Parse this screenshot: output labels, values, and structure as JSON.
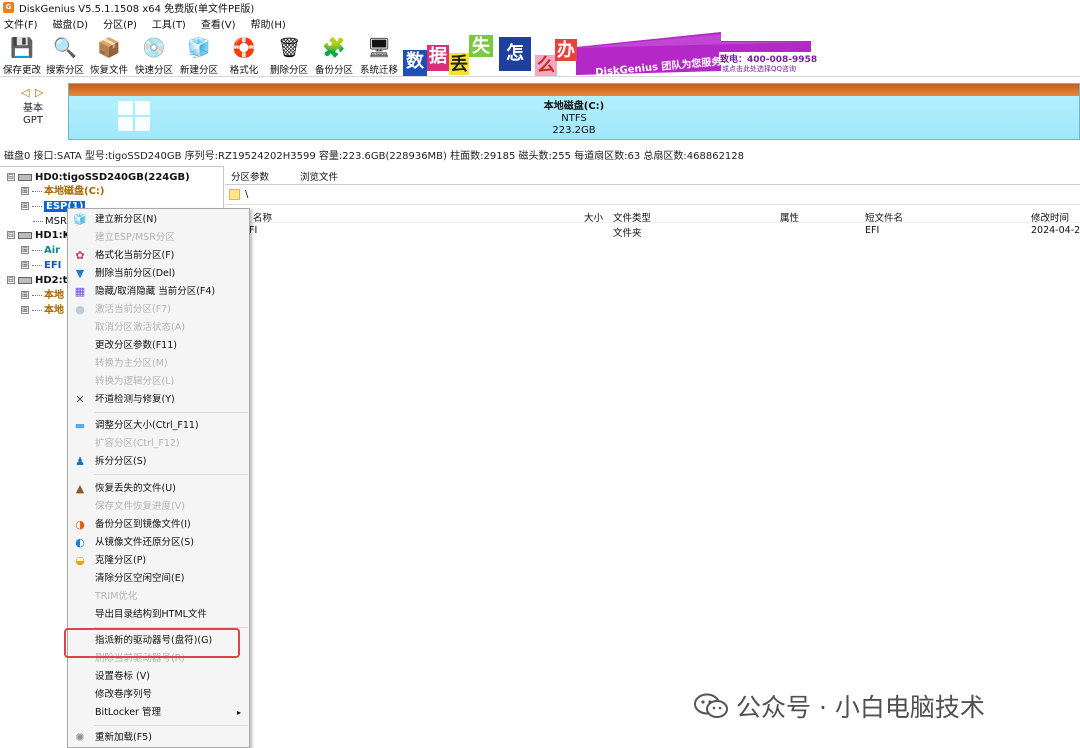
{
  "window": {
    "title": "DiskGenius V5.5.1.1508 x64 免费版(单文件PE版)",
    "app_icon_text": "G"
  },
  "menu": [
    {
      "label": "文件(F)"
    },
    {
      "label": "磁盘(D)"
    },
    {
      "label": "分区(P)"
    },
    {
      "label": "工具(T)"
    },
    {
      "label": "查看(V)"
    },
    {
      "label": "帮助(H)"
    }
  ],
  "toolbar": [
    {
      "label": "保存更改",
      "icon": "save-icon",
      "glyph": "💾"
    },
    {
      "label": "搜索分区",
      "icon": "search-icon",
      "glyph": "🔍"
    },
    {
      "label": "恢复文件",
      "icon": "restore-icon",
      "glyph": "📦"
    },
    {
      "label": "快速分区",
      "icon": "quick-partition-icon",
      "glyph": "💿"
    },
    {
      "label": "新建分区",
      "icon": "new-partition-icon",
      "glyph": "🧊"
    },
    {
      "label": "格式化",
      "icon": "format-icon",
      "glyph": "🛟"
    },
    {
      "label": "删除分区",
      "icon": "delete-icon",
      "glyph": "🗑"
    },
    {
      "label": "备份分区",
      "icon": "backup-icon",
      "glyph": "🧩"
    },
    {
      "label": "系统迁移",
      "icon": "migrate-icon",
      "glyph": "🖥"
    }
  ],
  "banner": {
    "chars": [
      "数",
      "据",
      "丢",
      "失",
      "怎",
      "么",
      "办"
    ],
    "slogan": "DiskGenius 团队为您服务",
    "phone": "致电：400-008-9958",
    "qq": "或点击此处选择QQ咨询"
  },
  "disk_map": {
    "nav": "◁ ▷",
    "type_line1": "基本",
    "type_line2": "GPT",
    "partition_name": "本地磁盘(C:)",
    "fs": "NTFS",
    "size": "223.2GB"
  },
  "disk_info": "磁盘0 接口:SATA  型号:tigoSSD240GB  序列号:RZ19524202H3599  容量:223.6GB(228936MB)  柱面数:29185  磁头数:255  每道扇区数:63  总扇区数:468862128",
  "tree": [
    {
      "label": "HD0:tigoSSD240GB(224GB)",
      "kind": "disk",
      "expand": "⊟"
    },
    {
      "label": "本地磁盘(C:)",
      "kind": "part-ntfs",
      "expand": "⊞"
    },
    {
      "label": "ESP(1)",
      "kind": "part-sel",
      "expand": "⊞"
    },
    {
      "label": "MSR",
      "kind": "part-msr",
      "expand": ""
    },
    {
      "label": "HD1:K",
      "kind": "disk",
      "expand": "⊟"
    },
    {
      "label": "Air",
      "kind": "part-teal",
      "expand": "⊞"
    },
    {
      "label": "EFI",
      "kind": "part-blue",
      "expand": "⊞"
    },
    {
      "label": "HD2:t",
      "kind": "disk",
      "expand": "⊟"
    },
    {
      "label": "本地",
      "kind": "part-ntfs",
      "expand": "⊞"
    },
    {
      "label": "本地",
      "kind": "part-ntfs",
      "expand": "⊞"
    }
  ],
  "panel": {
    "tabs": [
      "分区参数",
      "浏览文件"
    ],
    "path": "\\",
    "headers": {
      "name": "名称",
      "size": "大小",
      "type": "文件类型",
      "attr": "属性",
      "short": "短文件名",
      "mtime": "修改时间"
    },
    "rows": [
      {
        "name": "EFI",
        "type": "文件夹",
        "short": "EFI",
        "mtime": "2024-04-2"
      }
    ]
  },
  "context_menu": [
    {
      "label": "建立新分区(N)",
      "enabled": true,
      "icon": "new-partition-icon",
      "glyph": "🧊",
      "color": "#2b8a3e"
    },
    {
      "label": "建立ESP/MSR分区",
      "enabled": false,
      "icon": "",
      "glyph": "",
      "color": ""
    },
    {
      "label": "格式化当前分区(F)",
      "enabled": true,
      "icon": "format-icon",
      "glyph": "✿",
      "color": "#d6336c"
    },
    {
      "label": "删除当前分区(Del)",
      "enabled": true,
      "icon": "delete-icon",
      "glyph": "▼",
      "color": "#1c7ed6"
    },
    {
      "label": "隐藏/取消隐藏 当前分区(F4)",
      "enabled": true,
      "icon": "hide-icon",
      "glyph": "▦",
      "color": "#7048e8"
    },
    {
      "label": "激活当前分区(F7)",
      "enabled": false,
      "icon": "activate-icon",
      "glyph": "●",
      "color": "#bcd"
    },
    {
      "label": "取消分区激活状态(A)",
      "enabled": false,
      "icon": "",
      "glyph": "",
      "color": ""
    },
    {
      "label": "更改分区参数(F11)",
      "enabled": true,
      "icon": "",
      "glyph": "",
      "color": ""
    },
    {
      "label": "转换为主分区(M)",
      "enabled": false,
      "icon": "",
      "glyph": "",
      "color": ""
    },
    {
      "label": "转换为逻辑分区(L)",
      "enabled": false,
      "icon": "",
      "glyph": "",
      "color": ""
    },
    {
      "label": "坏道检测与修复(Y)",
      "enabled": true,
      "icon": "tools-icon",
      "glyph": "✕",
      "color": "#495057"
    },
    {
      "label": "调整分区大小(Ctrl_F11)",
      "enabled": true,
      "icon": "resize-icon",
      "glyph": "▬",
      "color": "#4dabf7"
    },
    {
      "label": "扩容分区(Ctrl_F12)",
      "enabled": false,
      "icon": "",
      "glyph": "",
      "color": ""
    },
    {
      "label": "拆分分区(S)",
      "enabled": true,
      "icon": "split-icon",
      "glyph": "♟",
      "color": "#1971c2"
    },
    {
      "label": "恢复丢失的文件(U)",
      "enabled": true,
      "icon": "restore-icon",
      "glyph": "▲",
      "color": "#8d5a2b"
    },
    {
      "label": "保存文件恢复进度(V)",
      "enabled": false,
      "icon": "",
      "glyph": "",
      "color": ""
    },
    {
      "label": "备份分区到镜像文件(I)",
      "enabled": true,
      "icon": "backup-icon",
      "glyph": "◑",
      "color": "#e8590c"
    },
    {
      "label": "从镜像文件还原分区(S)",
      "enabled": true,
      "icon": "restore-image-icon",
      "glyph": "◐",
      "color": "#1c7ed6"
    },
    {
      "label": "克隆分区(P)",
      "enabled": true,
      "icon": "clone-icon",
      "glyph": "◒",
      "color": "#f59f00"
    },
    {
      "label": "清除分区空闲空间(E)",
      "enabled": true,
      "icon": "",
      "glyph": "",
      "color": ""
    },
    {
      "label": "TRIM优化",
      "enabled": false,
      "icon": "",
      "glyph": "",
      "color": ""
    },
    {
      "label": "导出目录结构到HTML文件",
      "enabled": true,
      "icon": "",
      "glyph": "",
      "color": ""
    },
    {
      "label": "指派新的驱动器号(盘符)(G)",
      "enabled": true,
      "icon": "",
      "glyph": "",
      "color": ""
    },
    {
      "label": "删除当前驱动器号(R)",
      "enabled": false,
      "icon": "",
      "glyph": "",
      "color": ""
    },
    {
      "label": "设置卷标 (V)",
      "enabled": true,
      "icon": "",
      "glyph": "",
      "color": ""
    },
    {
      "label": "修改卷序列号",
      "enabled": true,
      "icon": "",
      "glyph": "",
      "color": ""
    },
    {
      "label": "BitLocker 管理",
      "enabled": true,
      "icon": "submenu-arrow-icon",
      "glyph": "",
      "color": ""
    },
    {
      "label": "重新加载(F5)",
      "enabled": true,
      "icon": "reload-icon",
      "glyph": "✺",
      "color": "#868e96"
    }
  ],
  "watermark": "公众号 · 小白电脑技术",
  "colors": {
    "accent_red": "#e04343",
    "partition_blue": "#a8edfc",
    "partition_top": "#d06a28",
    "selected": "#0a64d6"
  }
}
